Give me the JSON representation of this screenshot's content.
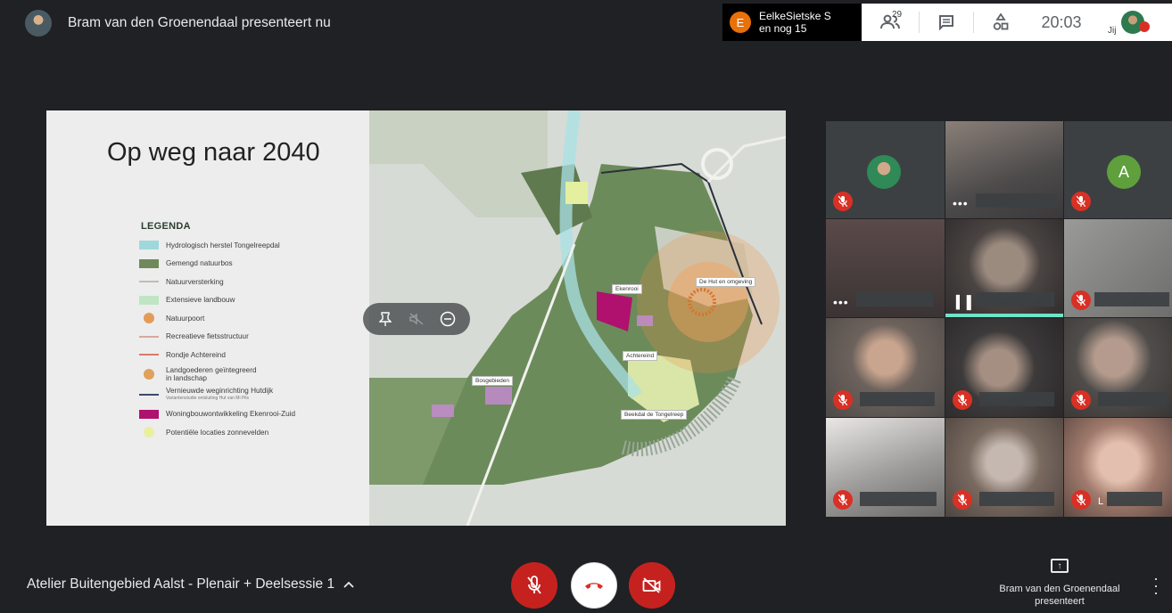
{
  "topbar": {
    "presenter_title": "Bram van den Groenendaal presenteert nu",
    "toast": {
      "initial": "E",
      "line1": "EelkeSietske S",
      "line2": "en nog 15"
    },
    "people_count": "29",
    "time": "20:03",
    "self_label": "Jij",
    "icons": [
      "people-icon",
      "chat-icon",
      "activities-icon"
    ]
  },
  "slide": {
    "title": "Op weg naar 2040",
    "legend_title": "LEGENDA",
    "legend": [
      {
        "label": "Hydrologisch herstel Tongelreepdal",
        "color": "#9fd8dc"
      },
      {
        "label": "Gemengd natuurbos",
        "color": "#6f8a5a"
      },
      {
        "label": "Natuurversterking",
        "color": "#b9c0b3"
      },
      {
        "label": "Extensieve landbouw",
        "color": "#bfe5c4"
      },
      {
        "label": "Natuurpoort",
        "color": "#e39b58"
      },
      {
        "label": "Recreatieve fietsstructuur",
        "color": "#d9a89a"
      },
      {
        "label": "Rondje Achtereind",
        "color": "#d97a6a"
      },
      {
        "label": "Landgoederen geïntegreerd\nin landschap",
        "color": "#e0a15a"
      },
      {
        "label": "Vernieuwde weginrichting Hutdijk",
        "sub": "Variantenstudie ontsluiting Hut van Mi Pils",
        "color": "#3a4a6a"
      },
      {
        "label": "Woningbouwontwikkeling Ekenrooi-Zuid",
        "color": "#b0106e"
      },
      {
        "label": "Potentiële locaties zonnevelden",
        "color": "#e8f0a0"
      }
    ],
    "map_labels": {
      "ekenrooi": "Ekenrooi",
      "hut": "De Hut en omgeving",
      "achtereind": "Achtereind",
      "bosgebieden": "Bosgebieden",
      "beekdal": "Beekdal de Tongelreep"
    }
  },
  "grid": {
    "tile_letter": "A",
    "tile_name_fragment": "L"
  },
  "bottombar": {
    "meeting_title": "Atelier Buitengebied Aalst - Plenair + Deelsessie 1",
    "presenting_label": "Bram van den Groenendaal presenteert",
    "accent_red": "#c5221f"
  }
}
